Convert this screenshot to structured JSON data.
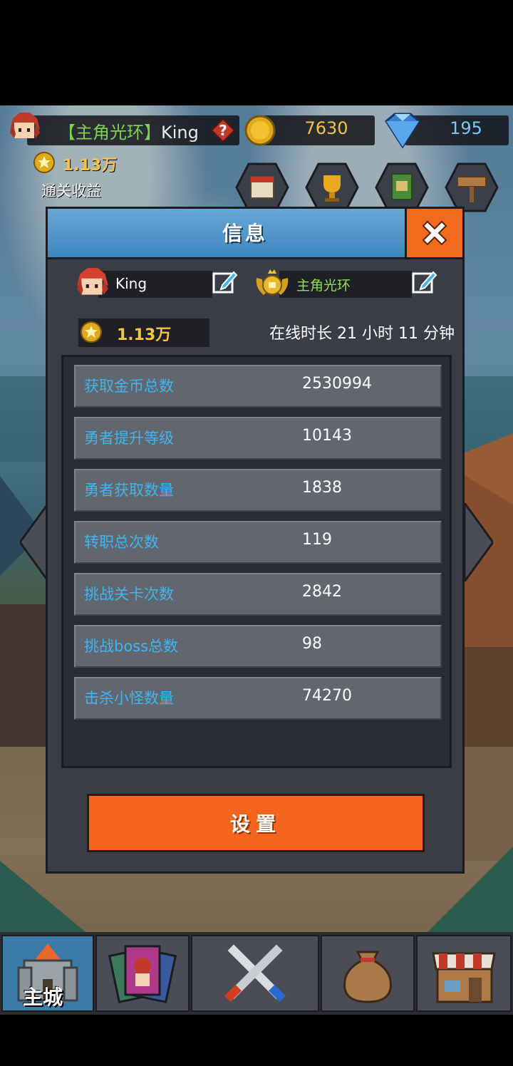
{
  "hud": {
    "title_prefix": "【主角光环】",
    "player_name": "King",
    "gold": "7630",
    "gems": "195"
  },
  "income": {
    "value": "1.13万",
    "label": "通关收益"
  },
  "modal": {
    "title": "信息",
    "player_name": "King",
    "player_title": "主角光环",
    "coins": "1.13万",
    "online_time": "在线时长 21 小时 11 分钟",
    "stats": [
      {
        "label": "获取金币总数",
        "value": "2530994"
      },
      {
        "label": "勇者提升等级",
        "value": "10143"
      },
      {
        "label": "勇者获取数量",
        "value": "1838"
      },
      {
        "label": "转职总次数",
        "value": "119"
      },
      {
        "label": "挑战关卡次数",
        "value": "2842"
      },
      {
        "label": "挑战boss总数",
        "value": "98"
      },
      {
        "label": "击杀小怪数量",
        "value": "74270"
      }
    ],
    "settings_label": "设置"
  },
  "nav": {
    "items": [
      {
        "label": "主城",
        "icon": "castle-icon",
        "active": true
      },
      {
        "label": "",
        "icon": "hero-cards-icon",
        "active": false
      },
      {
        "label": "",
        "icon": "crossed-swords-icon",
        "active": false
      },
      {
        "label": "",
        "icon": "loot-bag-icon",
        "active": false
      },
      {
        "label": "",
        "icon": "shop-icon",
        "active": false
      }
    ]
  },
  "colors": {
    "accent_orange": "#f4661d",
    "header_blue": "#4f93c9",
    "stat_label_blue": "#3fb5ef",
    "gold_yellow": "#f5c440",
    "title_green": "#8fe04a"
  }
}
